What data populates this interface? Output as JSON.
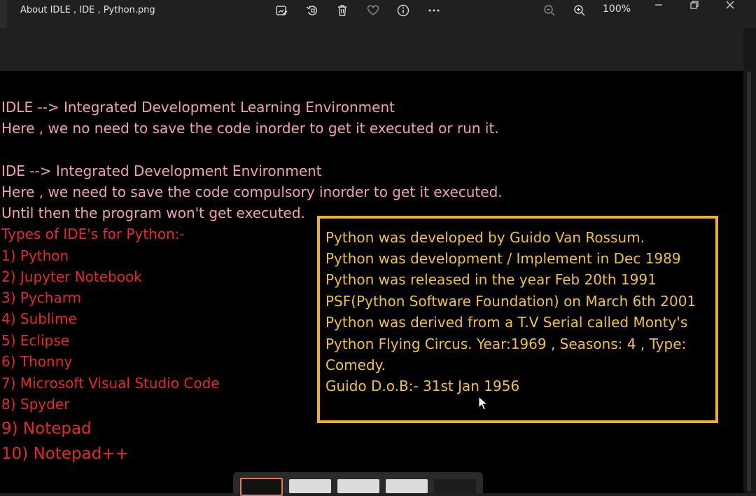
{
  "window": {
    "title": "About IDLE , IDE , Python.png",
    "zoom": "100%"
  },
  "toolbar_icons": [
    "edit-image-icon",
    "rotate-icon",
    "delete-icon",
    "favorite-icon",
    "info-icon",
    "more-icon",
    "zoom-out-icon",
    "zoom-in-icon",
    "minimize-icon",
    "restore-icon",
    "close-icon"
  ],
  "content": {
    "pink_lines": [
      "IDLE --> Integrated Development Learning Environment",
      "Here , we no need to save the code inorder to get it executed or run it.",
      "IDE --> Integrated Development Environment",
      "Here , we need to save the code compulsory inorder to get it executed.",
      "Until then the program won't get executed."
    ],
    "ide_heading": "Types of IDE's for Python:-",
    "ide_list": [
      "1) Python",
      "2) Jupyter Notebook",
      "3) Pycharm",
      "4) Sublime",
      "5) Eclipse",
      "6) Thonny",
      "7) Microsoft Visual Studio Code",
      "8) Spyder",
      "9) Notepad",
      "10) Notepad++"
    ],
    "info_box": [
      "Python was developed by Guido Van Rossum.",
      "Python was development / Implement in Dec 1989",
      "Python was released in the year Feb 20th 1991",
      "PSF(Python Software Foundation) on March 6th 2001",
      "Python was derived from a T.V Serial called Monty's",
      "Python Flying Circus. Year:1969  , Seasons: 4 , Type:",
      "Comedy.",
      "Guido D.o.B:- 31st Jan 1956"
    ]
  },
  "colors": {
    "pink_text": "#f2a0b0",
    "red_text": "#e8282a",
    "box_border": "#f0b12a",
    "box_text": "#f0c23a"
  }
}
